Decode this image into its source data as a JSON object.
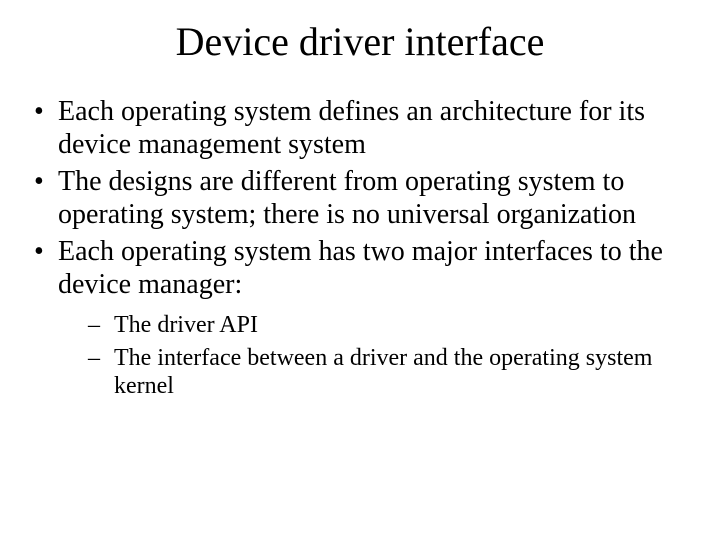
{
  "title": "Device driver interface",
  "bullets": [
    "Each operating system defines an architecture for its device management system",
    "The designs are different from operating system to operating system; there is no universal organization",
    "Each operating system has two major interfaces to the device manager:"
  ],
  "subbullets": [
    "The driver API",
    "The interface between a driver and the operating system kernel"
  ]
}
